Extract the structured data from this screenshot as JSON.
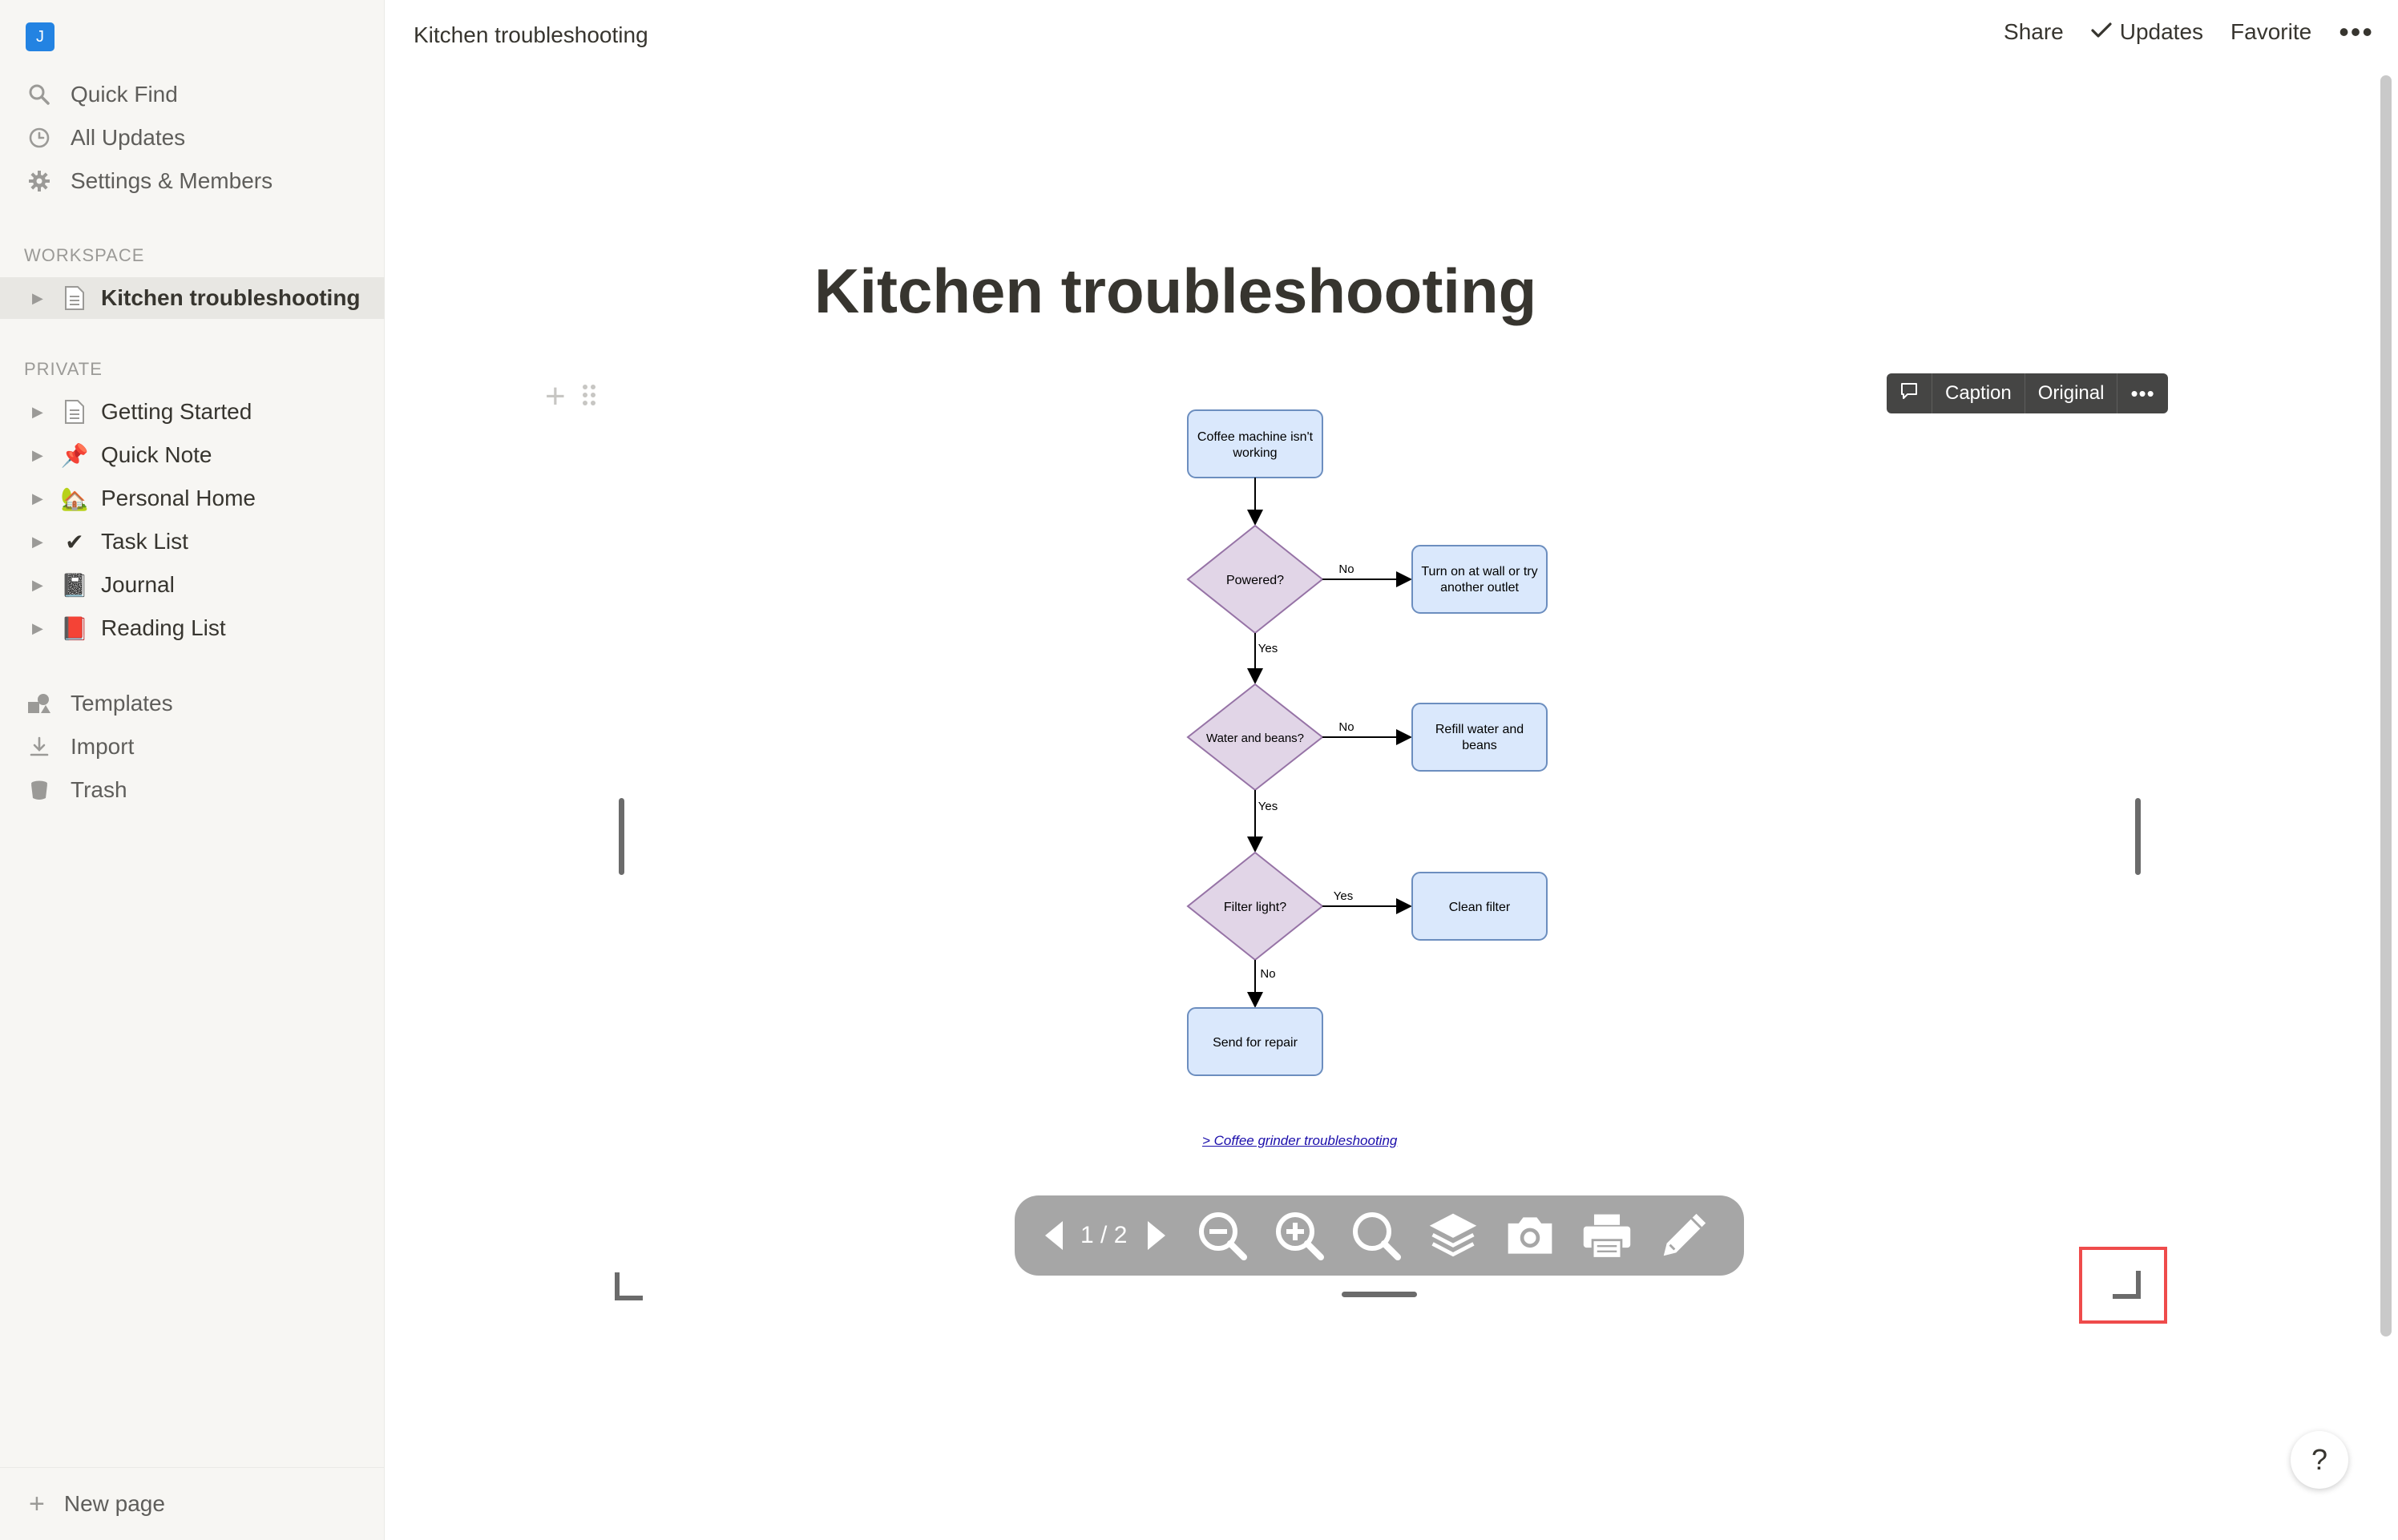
{
  "workspace": {
    "avatar_letter": "J"
  },
  "sidebar": {
    "nav": [
      {
        "label": "Quick Find",
        "icon": "search-icon"
      },
      {
        "label": "All Updates",
        "icon": "clock-icon"
      },
      {
        "label": "Settings & Members",
        "icon": "gear-icon"
      }
    ],
    "workspace_label": "WORKSPACE",
    "workspace_pages": [
      {
        "label": "Kitchen troubleshooting",
        "icon": "page-icon",
        "active": true
      }
    ],
    "private_label": "PRIVATE",
    "private_pages": [
      {
        "label": "Getting Started",
        "emoji": "📄"
      },
      {
        "label": "Quick Note",
        "emoji": "📌"
      },
      {
        "label": "Personal Home",
        "emoji": "🏡"
      },
      {
        "label": "Task List",
        "emoji": "✔"
      },
      {
        "label": "Journal",
        "emoji": "📓"
      },
      {
        "label": "Reading List",
        "emoji": "📕"
      }
    ],
    "tools": [
      {
        "label": "Templates",
        "icon": "templates-icon"
      },
      {
        "label": "Import",
        "icon": "import-icon"
      },
      {
        "label": "Trash",
        "icon": "trash-icon"
      }
    ],
    "new_page": "New page"
  },
  "topbar": {
    "breadcrumb": "Kitchen troubleshooting",
    "share": "Share",
    "updates": "Updates",
    "favorite": "Favorite"
  },
  "page": {
    "title": "Kitchen troubleshooting"
  },
  "image_toolbar": {
    "caption": "Caption",
    "original": "Original"
  },
  "flowchart": {
    "start": [
      "Coffee machine isn't",
      "working"
    ],
    "q1": "Powered?",
    "q1_no_action": [
      "Turn on at wall or try",
      "another outlet"
    ],
    "q2": "Water and beans?",
    "q2_no_action": [
      "Refill water and",
      "beans"
    ],
    "q3": "Filter light?",
    "q3_yes_action": "Clean filter",
    "end": "Send for repair",
    "label_yes": "Yes",
    "label_no": "No"
  },
  "link_text": "> Coffee grinder troubleshooting",
  "pdf_toolbar": {
    "page_indicator": "1 / 2"
  },
  "help": "?",
  "colors": {
    "sidebar_bg": "#f7f6f3",
    "accent_blue": "#2383e2",
    "flow_box_fill": "#dae8fc",
    "flow_box_stroke": "#6c8ebf",
    "flow_diamond_fill": "#e1d5e7",
    "flow_diamond_stroke": "#9673a6",
    "highlight_red": "#ef4b4b"
  }
}
